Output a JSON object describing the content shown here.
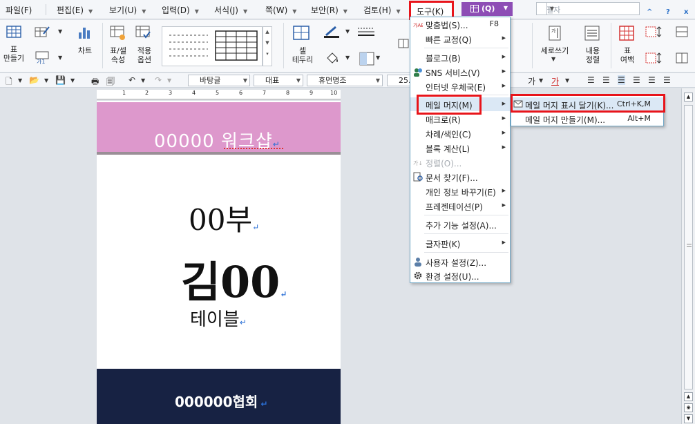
{
  "menubar": {
    "items": [
      "파일(F)",
      "편집(E)",
      "보기(U)",
      "입력(D)",
      "서식(J)",
      "쪽(W)",
      "보안(R)",
      "검토(H)"
    ],
    "active": "도구(K)",
    "table_tab": "(Q)",
    "find_placeholder": "필자",
    "window_controls": [
      "^",
      "?",
      "x"
    ]
  },
  "ribbon": {
    "table_label": "표\n만들기",
    "chart_label": "차트",
    "cell_prop_label": "표/셀\n속성",
    "apply_opts_label": "적용\n옵션",
    "cell_border_label": "셀\n테두리",
    "vertical_write_label": "세로쓰기",
    "content_align_label": "내용\n정렬",
    "table_margin_label": "표\n여백"
  },
  "format_bar": {
    "style": "바탕글",
    "lang": "대표",
    "font": "휴먼명조",
    "size": "25.0"
  },
  "document": {
    "header": "00000 워크샵",
    "line1": "00부",
    "line2": "김00",
    "line3": "테이블",
    "footer": "000000협회"
  },
  "ruler": {
    "labels": [
      "1",
      "2",
      "3",
      "4",
      "5",
      "6",
      "7",
      "8",
      "9",
      "10"
    ]
  },
  "tools_menu": {
    "items": [
      {
        "label": "맞춤법(S)...",
        "shortcut": "F8",
        "sub": false,
        "disabled": false
      },
      {
        "label": "빠른 교정(Q)",
        "shortcut": "",
        "sub": true,
        "disabled": false
      },
      {
        "label": "블로그(B)",
        "shortcut": "",
        "sub": true,
        "disabled": false
      },
      {
        "label": "SNS 서비스(V)",
        "shortcut": "",
        "sub": true,
        "disabled": false
      },
      {
        "label": "인터넷 우체국(E)",
        "shortcut": "",
        "sub": true,
        "disabled": false
      },
      {
        "label": "메일 머지(M)",
        "shortcut": "",
        "sub": true,
        "disabled": false
      },
      {
        "label": "매크로(R)",
        "shortcut": "",
        "sub": true,
        "disabled": false
      },
      {
        "label": "차례/색인(C)",
        "shortcut": "",
        "sub": true,
        "disabled": false
      },
      {
        "label": "블록 계산(L)",
        "shortcut": "",
        "sub": true,
        "disabled": false
      },
      {
        "label": "정렬(O)...",
        "shortcut": "",
        "sub": false,
        "disabled": true
      },
      {
        "label": "문서 찾기(F)...",
        "shortcut": "",
        "sub": false,
        "disabled": false
      },
      {
        "label": "개인 정보 바꾸기(E)",
        "shortcut": "",
        "sub": true,
        "disabled": false
      },
      {
        "label": "프레젠테이션(P)",
        "shortcut": "",
        "sub": true,
        "disabled": false
      },
      {
        "label": "추가 기능 설정(A)...",
        "shortcut": "",
        "sub": false,
        "disabled": false
      },
      {
        "label": "글자판(K)",
        "shortcut": "",
        "sub": true,
        "disabled": false
      },
      {
        "label": "사용자 설정(Z)...",
        "shortcut": "",
        "sub": false,
        "disabled": false
      },
      {
        "label": "환경 설정(U)...",
        "shortcut": "",
        "sub": false,
        "disabled": false
      }
    ]
  },
  "mail_merge_submenu": {
    "items": [
      {
        "label": "메일 머지 표시 달기(K)...",
        "shortcut": "Ctrl+K,M"
      },
      {
        "label": "메일 머지 만들기(M)...",
        "shortcut": "Alt+M"
      }
    ]
  },
  "colors": {
    "highlight_red": "#e8141a",
    "table_tab_purple": "#8d4db5",
    "pink_band": "#dd98cc",
    "navy_band": "#172243"
  }
}
